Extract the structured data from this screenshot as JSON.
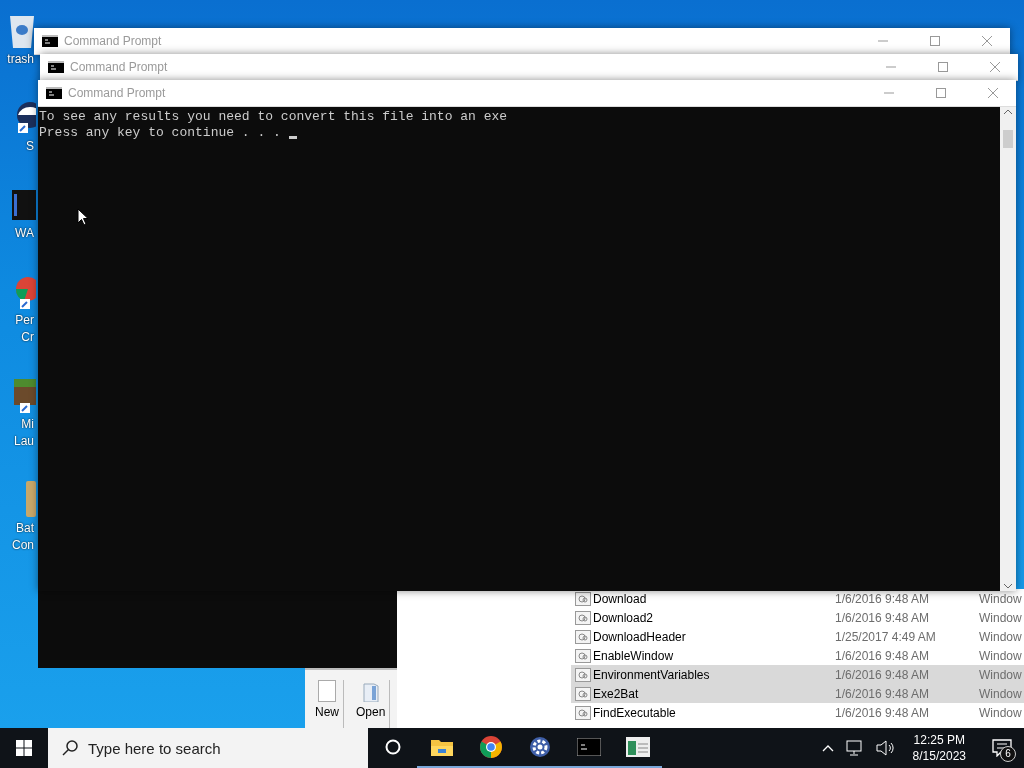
{
  "desktop_icons": [
    {
      "kind": "bin",
      "lines": [
        "trash"
      ]
    },
    {
      "kind": "shortcut",
      "lines": [
        "S"
      ]
    },
    {
      "kind": "film",
      "lines": [
        "WA"
      ]
    },
    {
      "kind": "chrome",
      "lines": [
        "Per",
        "Cr"
      ]
    },
    {
      "kind": "block",
      "lines": [
        "Mi",
        "Lau"
      ]
    },
    {
      "kind": "file",
      "lines": [
        "Bat",
        "Con"
      ]
    }
  ],
  "explorer": {
    "rows": [
      {
        "name": "Download",
        "date": "1/6/2016 9:48 AM",
        "type": "Window",
        "selected": false
      },
      {
        "name": "Download2",
        "date": "1/6/2016 9:48 AM",
        "type": "Window",
        "selected": false
      },
      {
        "name": "DownloadHeader",
        "date": "1/25/2017 4:49 AM",
        "type": "Window",
        "selected": false
      },
      {
        "name": "EnableWindow",
        "date": "1/6/2016 9:48 AM",
        "type": "Window",
        "selected": false
      },
      {
        "name": "EnvironmentVariables",
        "date": "1/6/2016 9:48 AM",
        "type": "Window",
        "selected": true
      },
      {
        "name": "Exe2Bat",
        "date": "1/6/2016 9:48 AM",
        "type": "Window",
        "selected": true
      },
      {
        "name": "FindExecutable",
        "date": "1/6/2016 9:48 AM",
        "type": "Window",
        "selected": false
      }
    ]
  },
  "editor": {
    "buttons": [
      {
        "kind": "new",
        "label": "New"
      },
      {
        "kind": "open",
        "label": "Open"
      }
    ]
  },
  "cmd_windows": [
    {
      "title": "Command Prompt"
    },
    {
      "title": "Command Prompt"
    },
    {
      "title": "Command Prompt",
      "console": [
        "To see any results you need to convert this file into an exe",
        "Press any key to continue . . . "
      ]
    }
  ],
  "taskbar": {
    "search": {
      "placeholder": "Type here to search"
    },
    "apps": [
      {
        "kind": "cortana",
        "running": false
      },
      {
        "kind": "folder",
        "running": true
      },
      {
        "kind": "chrome",
        "running": true
      },
      {
        "kind": "gear",
        "running": true
      },
      {
        "kind": "console",
        "running": true
      },
      {
        "kind": "notepad",
        "running": true
      }
    ],
    "time": "12:25 PM",
    "date": "8/15/2023",
    "notifications": "6"
  }
}
